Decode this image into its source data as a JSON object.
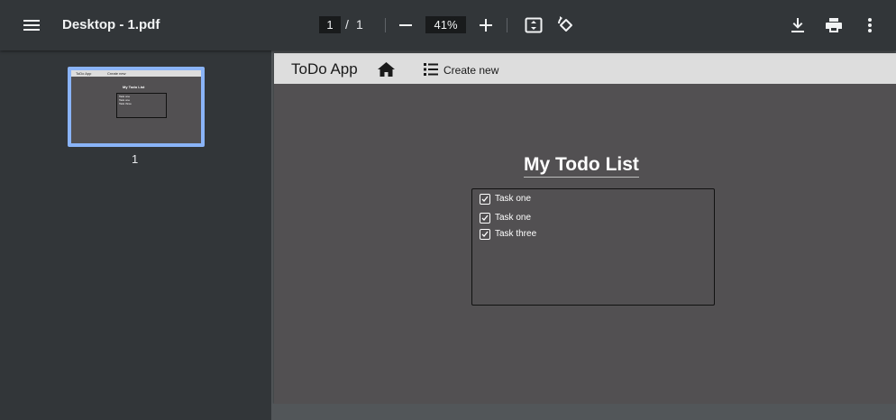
{
  "toolbar": {
    "menu_icon": "hamburger-menu-icon",
    "title": "Desktop - 1.pdf",
    "page_current": "1",
    "page_separator": "/",
    "page_total": "1",
    "zoom_out_icon": "minus-icon",
    "zoom_level": "41%",
    "zoom_in_icon": "plus-icon",
    "fit_icon": "fit-to-page-icon",
    "rotate_icon": "rotate-icon",
    "download_icon": "download-icon",
    "print_icon": "print-icon",
    "more_icon": "more-vert-icon"
  },
  "sidebar": {
    "thumbnail_label": "1",
    "thumbnail": {
      "brand": "ToDo App",
      "create": "Create new",
      "title": "My Todo List",
      "items": [
        "Task one",
        "Task one",
        "Task three"
      ]
    }
  },
  "document": {
    "nav": {
      "brand": "ToDo App",
      "home_icon": "home-icon",
      "list_icon": "list-icon",
      "create_label": "Create new"
    },
    "heading": "My Todo List",
    "todos": [
      {
        "label": "Task one",
        "checked": true
      },
      {
        "label": "Task one",
        "checked": true
      },
      {
        "label": "Task three",
        "checked": true
      }
    ]
  },
  "colors": {
    "toolbar_bg": "#323639",
    "viewer_bg": "#525659",
    "page_bg": "#525052",
    "nav_bg": "#dddddd",
    "thumb_highlight": "#8ab4f8"
  }
}
